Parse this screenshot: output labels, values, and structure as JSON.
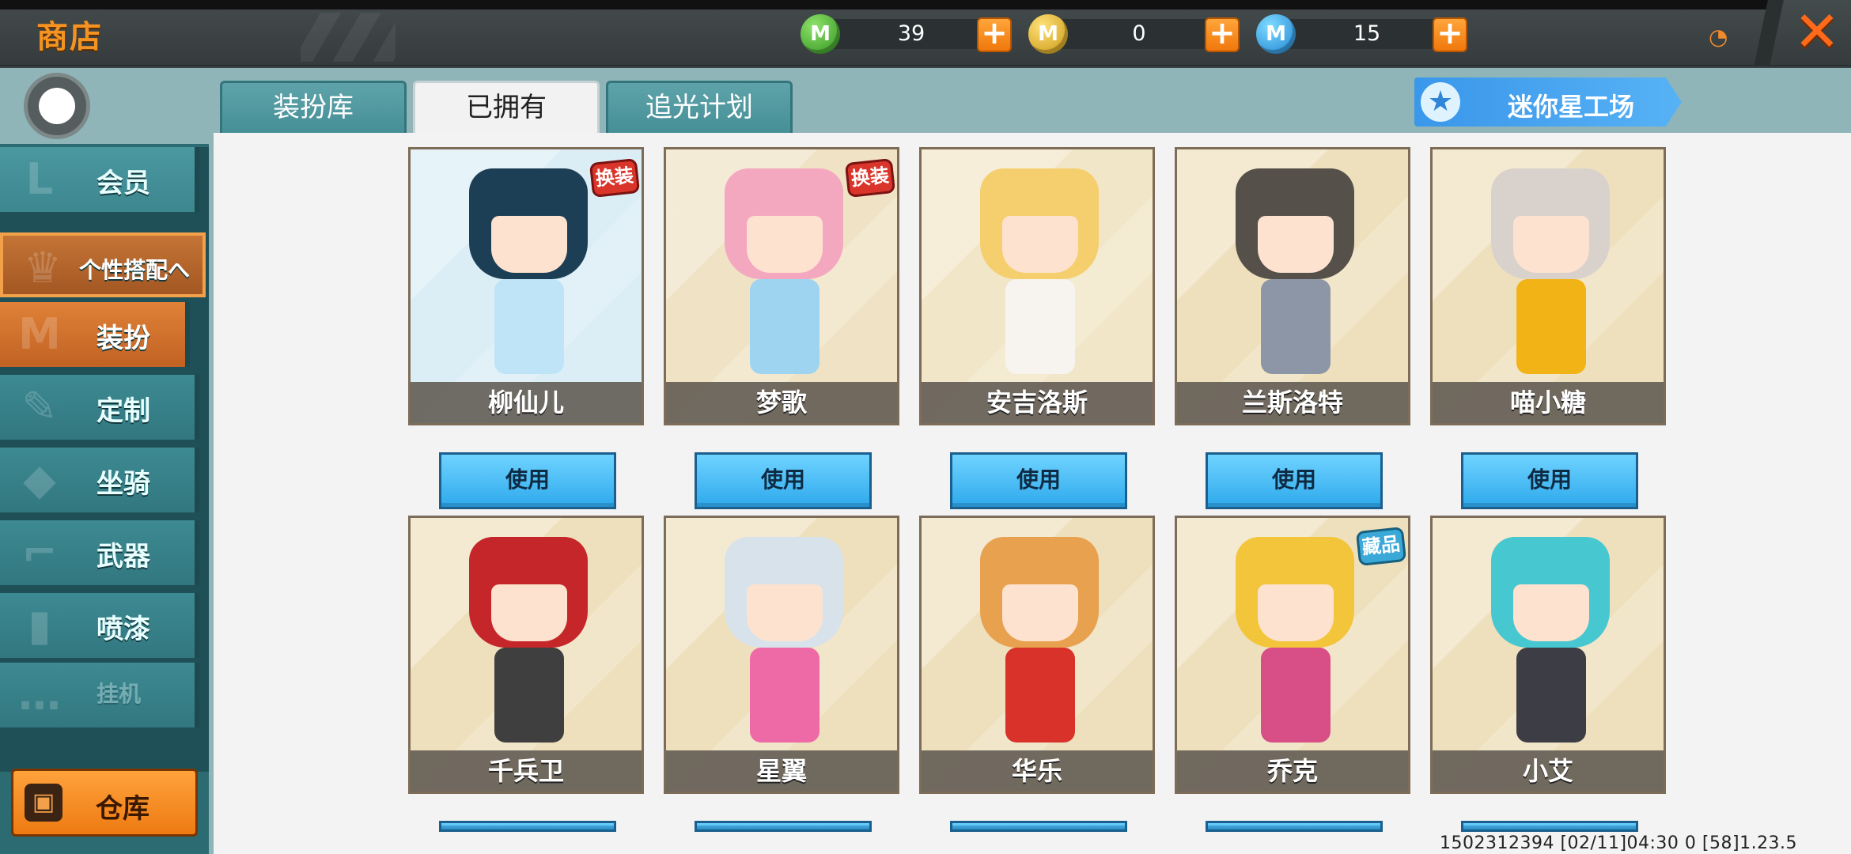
{
  "header": {
    "title": "商店"
  },
  "currencies": [
    {
      "icon": "mini-bean-green-coin-icon",
      "glyph": "M",
      "amount": "39"
    },
    {
      "icon": "gold-coin-icon",
      "glyph": "M",
      "amount": "0"
    },
    {
      "icon": "mini-coin-blue-icon",
      "glyph": "M",
      "amount": "15"
    }
  ],
  "plus_glyph": "+",
  "close_glyph": "✕",
  "sidebar": {
    "items": [
      {
        "label": "会员",
        "icon": "member-icon",
        "state": "normal"
      },
      {
        "label": "个性搭配へ",
        "icon": "trophy-icon",
        "state": "group"
      },
      {
        "label": "装扮",
        "icon": "outfit-icon",
        "state": "active"
      },
      {
        "label": "定制",
        "icon": "pencil-icon",
        "state": "normal"
      },
      {
        "label": "坐骑",
        "icon": "mount-icon",
        "state": "normal"
      },
      {
        "label": "武器",
        "icon": "gun-icon",
        "state": "normal"
      },
      {
        "label": "喷漆",
        "icon": "spray-can-icon",
        "state": "normal"
      },
      {
        "label": "挂机",
        "icon": "more-icon",
        "state": "dim"
      }
    ],
    "warehouse_label": "仓库"
  },
  "tabs": [
    {
      "label": "装扮库",
      "selected": false
    },
    {
      "label": "已拥有",
      "selected": true
    },
    {
      "label": "追光计划",
      "selected": false
    }
  ],
  "workshop_button": "迷你星工场",
  "use_label": "使用",
  "characters": [
    {
      "name": "柳仙儿",
      "badge": "换装",
      "badge_color": "red",
      "hair": "#1d3f55",
      "outfit": "#bfe4f7",
      "bg": "#dbeef6"
    },
    {
      "name": "梦歌",
      "badge": "换装",
      "badge_color": "red",
      "hair": "#f4a8c0",
      "outfit": "#9fd4f0",
      "bg": "#f0e2c4"
    },
    {
      "name": "安吉洛斯",
      "badge": "",
      "badge_color": "",
      "hair": "#f5cf6e",
      "outfit": "#f7f4ef",
      "bg": "#f2e6c8"
    },
    {
      "name": "兰斯洛特",
      "badge": "",
      "badge_color": "",
      "hair": "#55504a",
      "outfit": "#8d96a6",
      "bg": "#efe0bd"
    },
    {
      "name": "喵小糖",
      "badge": "",
      "badge_color": "",
      "hair": "#d9d2cc",
      "outfit": "#f2b317",
      "bg": "#efe0bd"
    },
    {
      "name": "千兵卫",
      "badge": "",
      "badge_color": "",
      "hair": "#c5262a",
      "outfit": "#3f3f3f",
      "bg": "#efe0bd"
    },
    {
      "name": "星翼",
      "badge": "",
      "badge_color": "",
      "hair": "#d7e2ea",
      "outfit": "#ee6aa6",
      "bg": "#efe0bd"
    },
    {
      "name": "华乐",
      "badge": "",
      "badge_color": "",
      "hair": "#e8a14f",
      "outfit": "#d8322a",
      "bg": "#efe0bd"
    },
    {
      "name": "乔克",
      "badge": "藏品",
      "badge_color": "blue",
      "hair": "#f3c53b",
      "outfit": "#d84e86",
      "bg": "#efe0bd"
    },
    {
      "name": "小艾",
      "badge": "",
      "badge_color": "",
      "hair": "#47c7d0",
      "outfit": "#3d3d46",
      "bg": "#efe0bd"
    }
  ],
  "footer": {
    "text": "1502312394    [02/11]04:30 0    [58]1.23.5"
  }
}
